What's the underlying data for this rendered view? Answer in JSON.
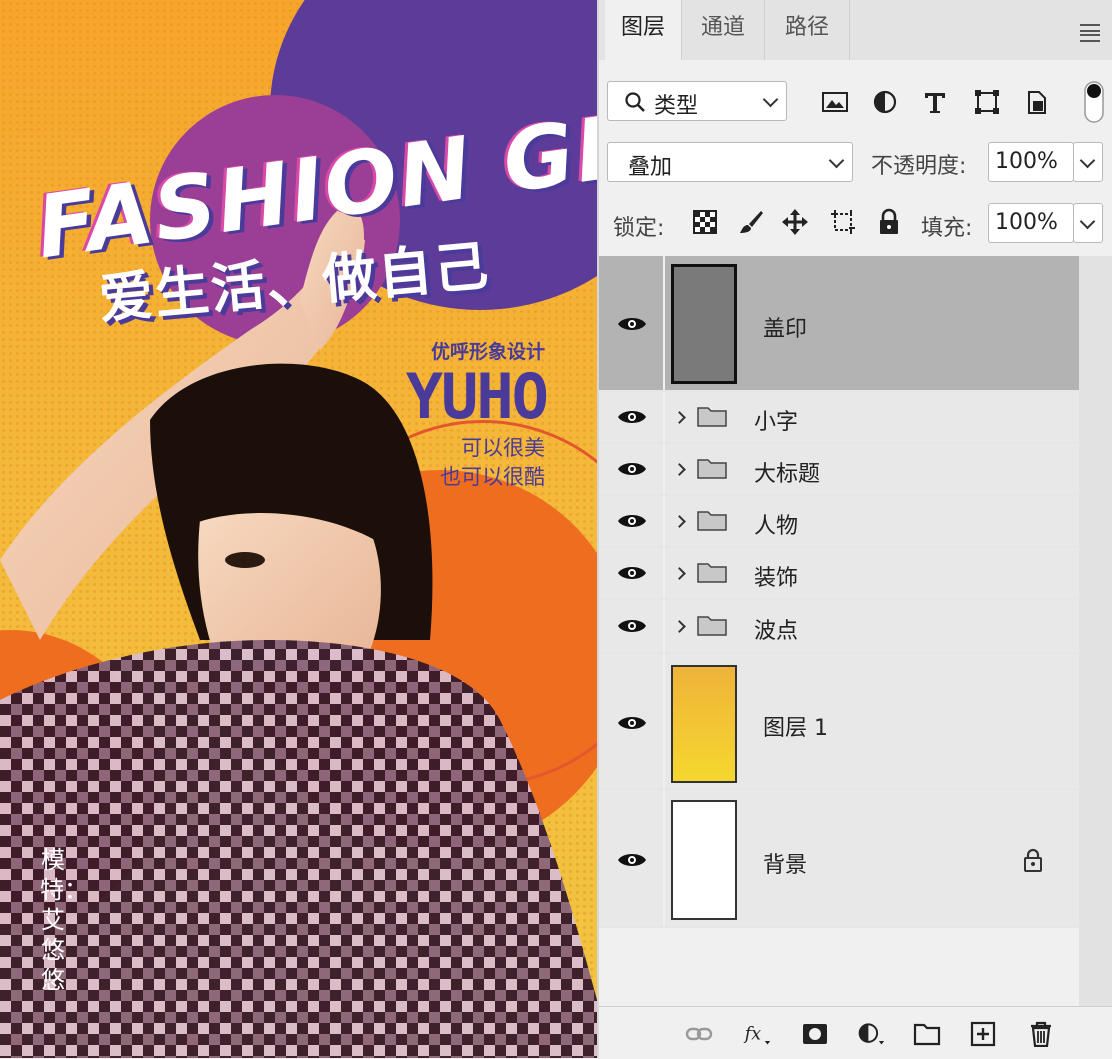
{
  "poster": {
    "title": "FASHION GIRL",
    "slogan": "爱生活、做自己",
    "brand_sub": "优呼形象设计",
    "brand": "YUHO",
    "tagline_1": "可以很美",
    "tagline_2": "也可以很酷",
    "model_credit": "模特：艾悠悠"
  },
  "panel": {
    "tabs": [
      {
        "label": "图层",
        "active": true
      },
      {
        "label": "通道",
        "active": false
      },
      {
        "label": "路径",
        "active": false
      }
    ],
    "filter": {
      "label": "类型"
    },
    "filter_icons": [
      "image-filter-icon",
      "adjustment-filter-icon",
      "type-filter-icon",
      "shape-filter-icon",
      "smart-object-filter-icon"
    ],
    "blend_mode": "叠加",
    "opacity_label": "不透明度:",
    "opacity_value": "100%",
    "lock_label": "锁定:",
    "fill_label": "填充:",
    "fill_value": "100%",
    "layers": [
      {
        "name": "盖印",
        "type": "pixel",
        "selected": true,
        "thumb": "#7a7a7a"
      },
      {
        "name": "小字",
        "type": "group"
      },
      {
        "name": "大标题",
        "type": "group"
      },
      {
        "name": "人物",
        "type": "group"
      },
      {
        "name": "装饰",
        "type": "group"
      },
      {
        "name": "波点",
        "type": "group"
      },
      {
        "name": "图层 1",
        "type": "pixel",
        "thumb": "#f2c437"
      },
      {
        "name": "背景",
        "type": "background",
        "locked": true,
        "thumb": "#ffffff"
      }
    ],
    "colors": {
      "selected_row": "#b3b3b3",
      "row": "#e8e8e8",
      "accent_purple": "#4a3a9a",
      "accent_orange": "#ef6d1f"
    }
  }
}
